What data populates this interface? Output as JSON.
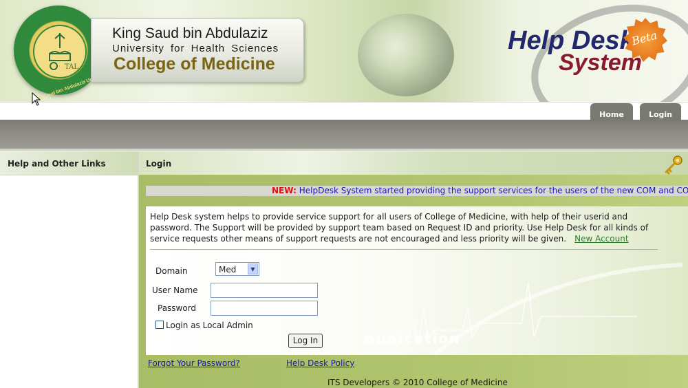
{
  "header": {
    "university_line1": "King Saud bin Abdulaziz",
    "university_line2": "University for Health Sciences",
    "college": "College of Medicine",
    "seal_ring_text": "King Saud bin Abdulaziz University for Health Sciences",
    "app_title_line1": "Help Desk",
    "app_title_line2": "System",
    "badge": "Beta"
  },
  "nav": {
    "tabs": [
      {
        "label": "Home"
      },
      {
        "label": "Login"
      }
    ]
  },
  "sidebar": {
    "title": "Help and Other Links"
  },
  "main": {
    "title": "Login",
    "announcement": {
      "tag": "NEW:",
      "text": "HelpDesk System started providing the support services for the users of the new COM and CON fem"
    },
    "intro": "Help Desk system helps to provide service support for all users of College of Medicine, with help of their userid and password. The Support will be provided by support team based on Request ID and priority. Use Help Desk for all kinds of service requests other means of support requests are not encouraged and less priority will be given.",
    "new_account_link": "New Account",
    "form": {
      "domain_label": "Domain",
      "domain_value": "Med",
      "username_label": "User Name",
      "username_value": "",
      "password_label": "Password",
      "password_value": "",
      "local_admin_label": "Login as Local Admin",
      "local_admin_checked": false,
      "submit_label": "Log In"
    },
    "background_text": "nunication",
    "links": {
      "forgot_password": "Forgot Your Password?",
      "policy": "Help Desk Policy"
    },
    "footer": "ITS Developers © 2010 College of Medicine"
  },
  "colors": {
    "nav_bar": "#7b7a72",
    "content_green": "#a9bd66",
    "link_blue": "#1a1aa8",
    "new_red": "#e01010",
    "brand_navy": "#22286d",
    "brand_maroon": "#8a1a2b",
    "brand_gold": "#7a6312"
  },
  "icons": [
    "key-icon",
    "chevron-down-icon",
    "mouse-cursor-icon"
  ]
}
